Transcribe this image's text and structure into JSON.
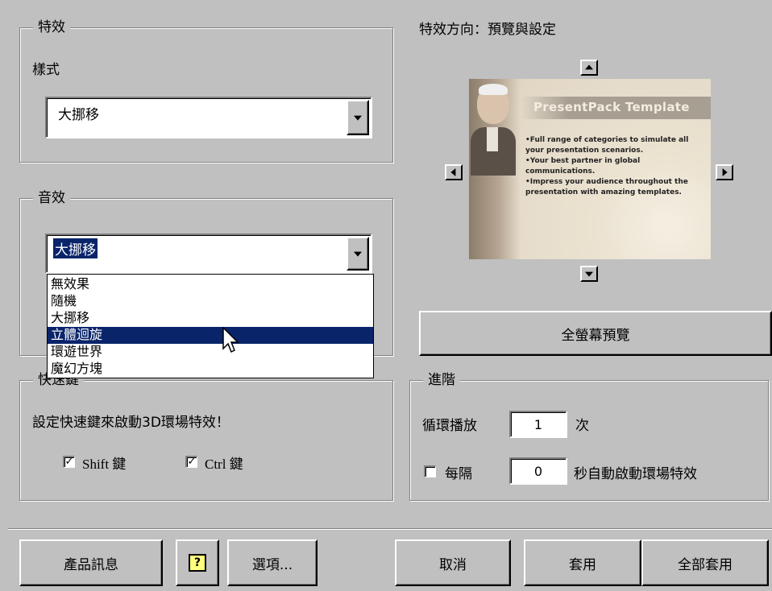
{
  "effects": {
    "legend": "特效",
    "style_label": "樣式",
    "style_value": "大挪移"
  },
  "sound": {
    "legend": "音效",
    "value": "大挪移",
    "options": [
      "無效果",
      "隨機",
      "大挪移",
      "立體迴旋",
      "環遊世界",
      "魔幻方塊"
    ],
    "highlighted": "立體迴旋"
  },
  "hotkey": {
    "legend": "快速鍵",
    "description": "設定快速鍵來啟動3D環場特效！",
    "shift_label": "Shift 鍵",
    "shift_checked": "✓",
    "ctrl_label": "Ctrl 鍵",
    "ctrl_checked": "✓"
  },
  "direction": {
    "title": "特效方向：預覽與設定",
    "preview": {
      "template_title": "PresentPack Template",
      "bullets": [
        "•Full range of categories to simulate all your presentation scenarios.",
        "•Your best partner in global communications.",
        "•Impress your audience throughout the presentation with amazing templates."
      ]
    },
    "fullscreen_button": "全螢幕預覽"
  },
  "advanced": {
    "legend": "進階",
    "loop_label": "循環播放",
    "loop_value": "1",
    "loop_unit": "次",
    "interval_label": "每隔",
    "interval_value": "0",
    "interval_unit": "秒自動啟動環場特效"
  },
  "footer": {
    "product_info": "產品訊息",
    "help_icon": "?",
    "options": "選項...",
    "cancel": "取消",
    "apply": "套用",
    "apply_all": "全部套用"
  },
  "colors": {
    "dialog_bg": "#c0c0c0",
    "selection": "#0a246a",
    "preview_title_bg": "#a89f93"
  }
}
